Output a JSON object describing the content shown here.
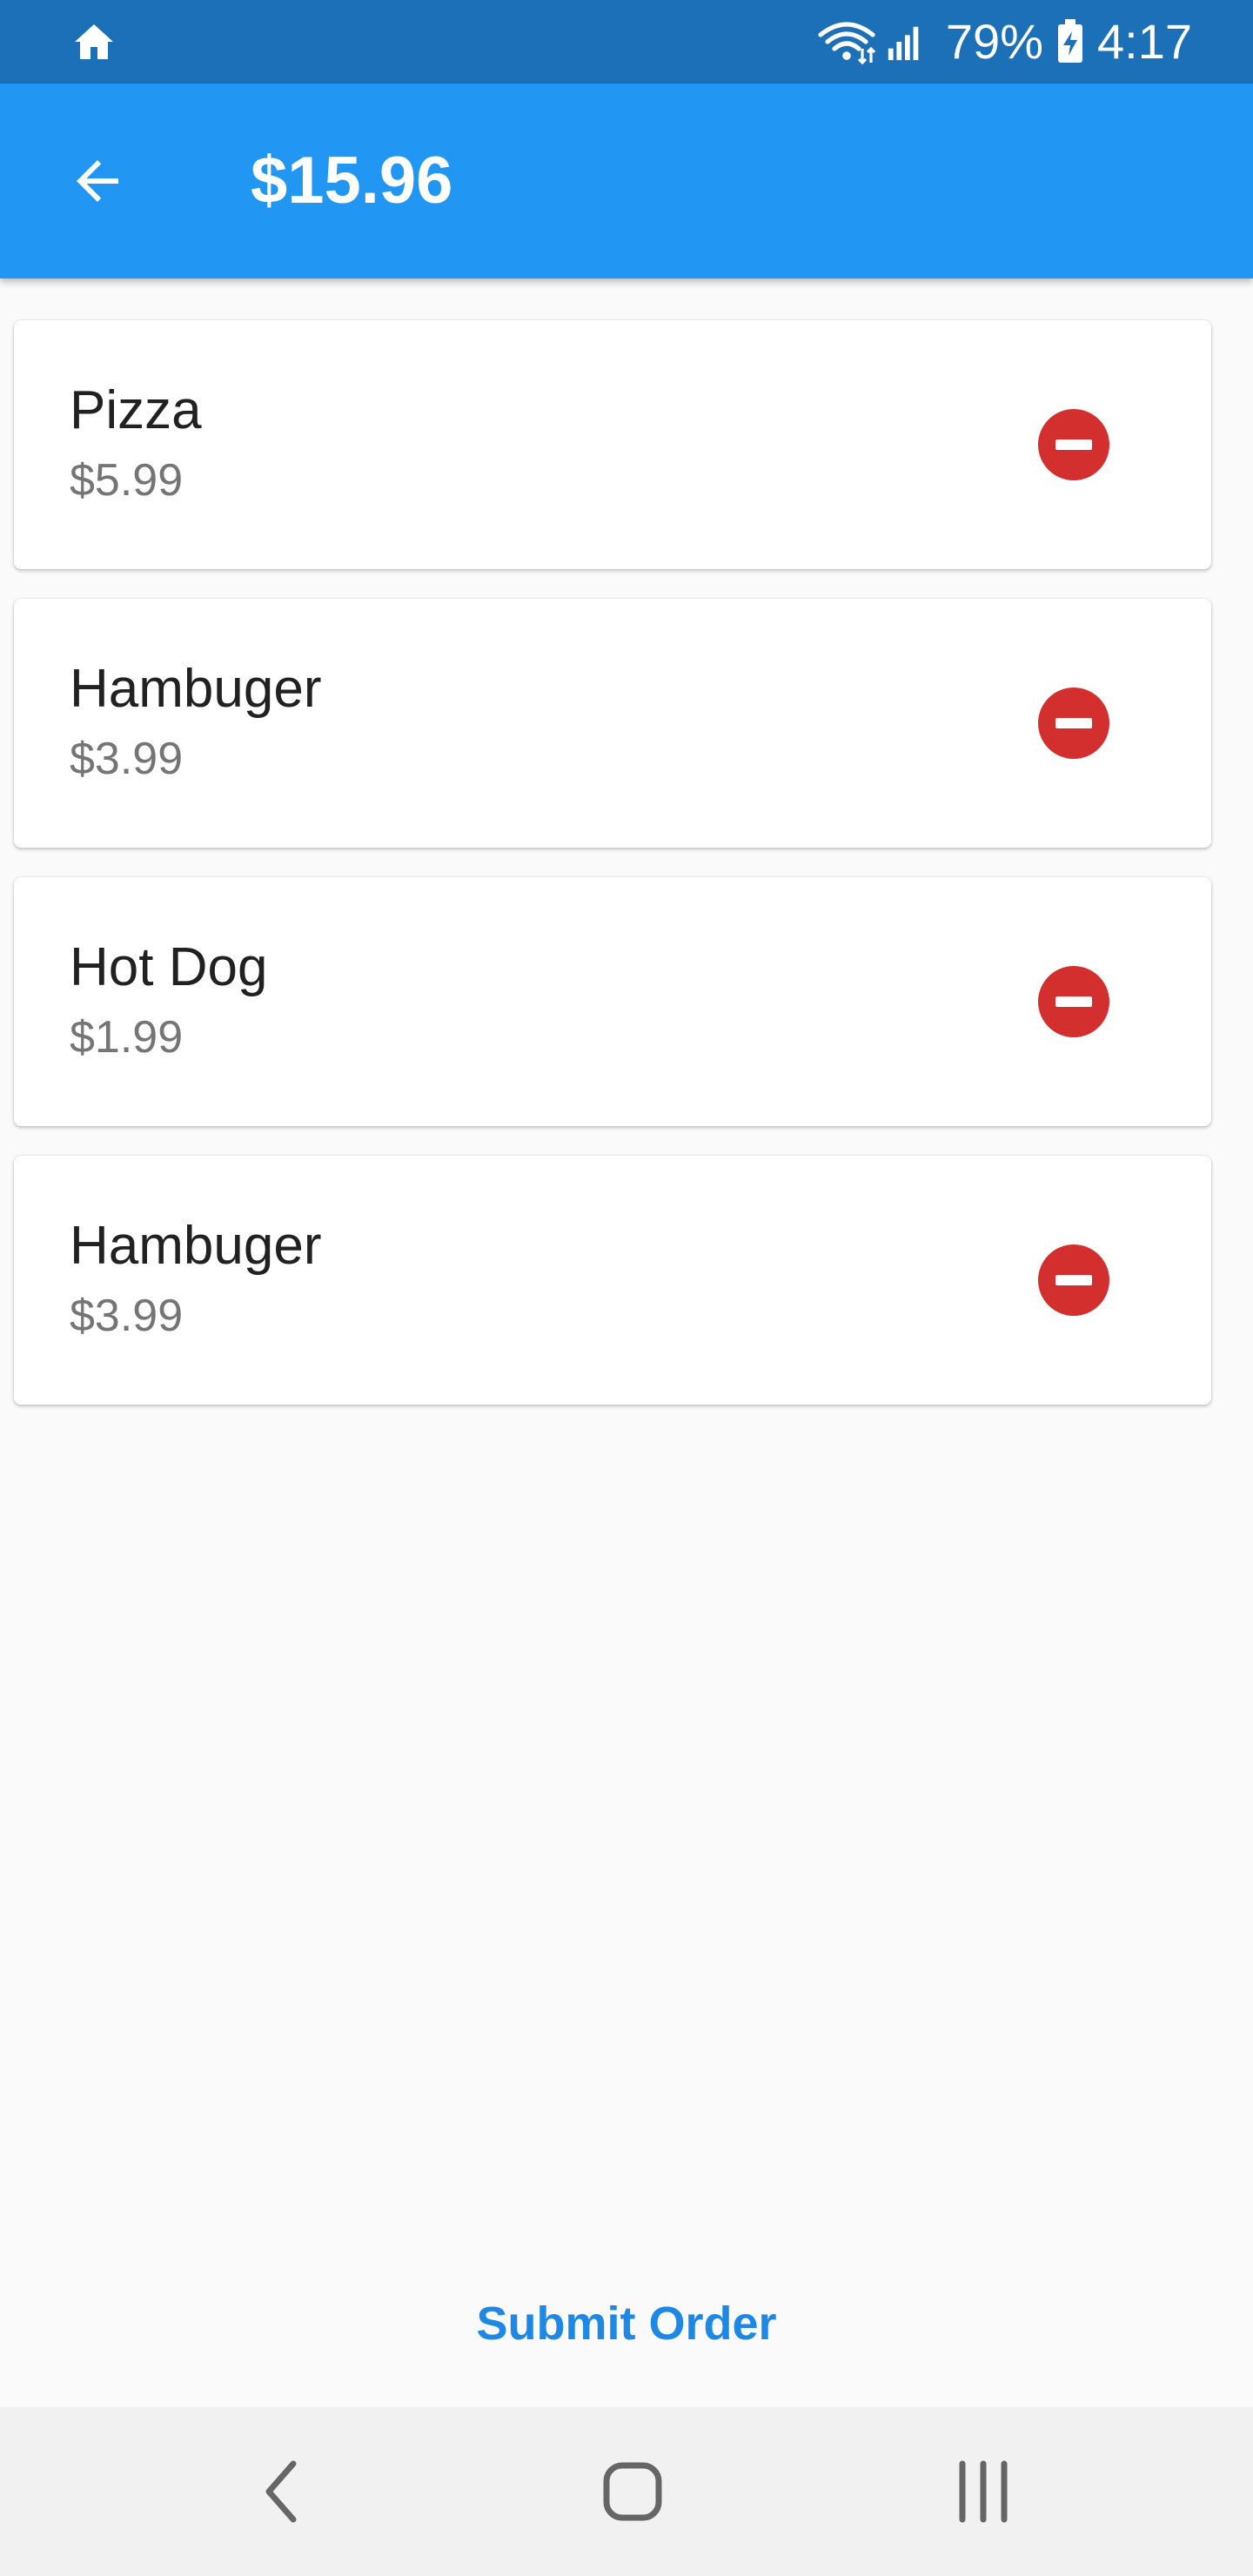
{
  "status_bar": {
    "battery_percent": "79%",
    "time": "4:17"
  },
  "app_bar": {
    "title": "$15.96"
  },
  "cart": {
    "items": [
      {
        "name": "Pizza",
        "price": "$5.99"
      },
      {
        "name": "Hambuger",
        "price": "$3.99"
      },
      {
        "name": "Hot Dog",
        "price": "$1.99"
      },
      {
        "name": "Hambuger",
        "price": "$3.99"
      }
    ]
  },
  "actions": {
    "submit_label": "Submit Order"
  },
  "colors": {
    "status_bar": "#1b70b8",
    "app_bar": "#2196f3",
    "remove_icon": "#d32f2f",
    "submit_text": "#1e88e5",
    "background": "#fafafa"
  },
  "icons": {
    "status_home": "home-icon",
    "wifi": "wifi-icon",
    "signal": "signal-icon",
    "battery": "battery-charging-icon",
    "back": "arrow-back-icon",
    "remove": "remove-circle-icon",
    "nav_back": "chevron-left-icon",
    "nav_home": "rounded-square-icon",
    "nav_recent": "recent-apps-icon"
  }
}
